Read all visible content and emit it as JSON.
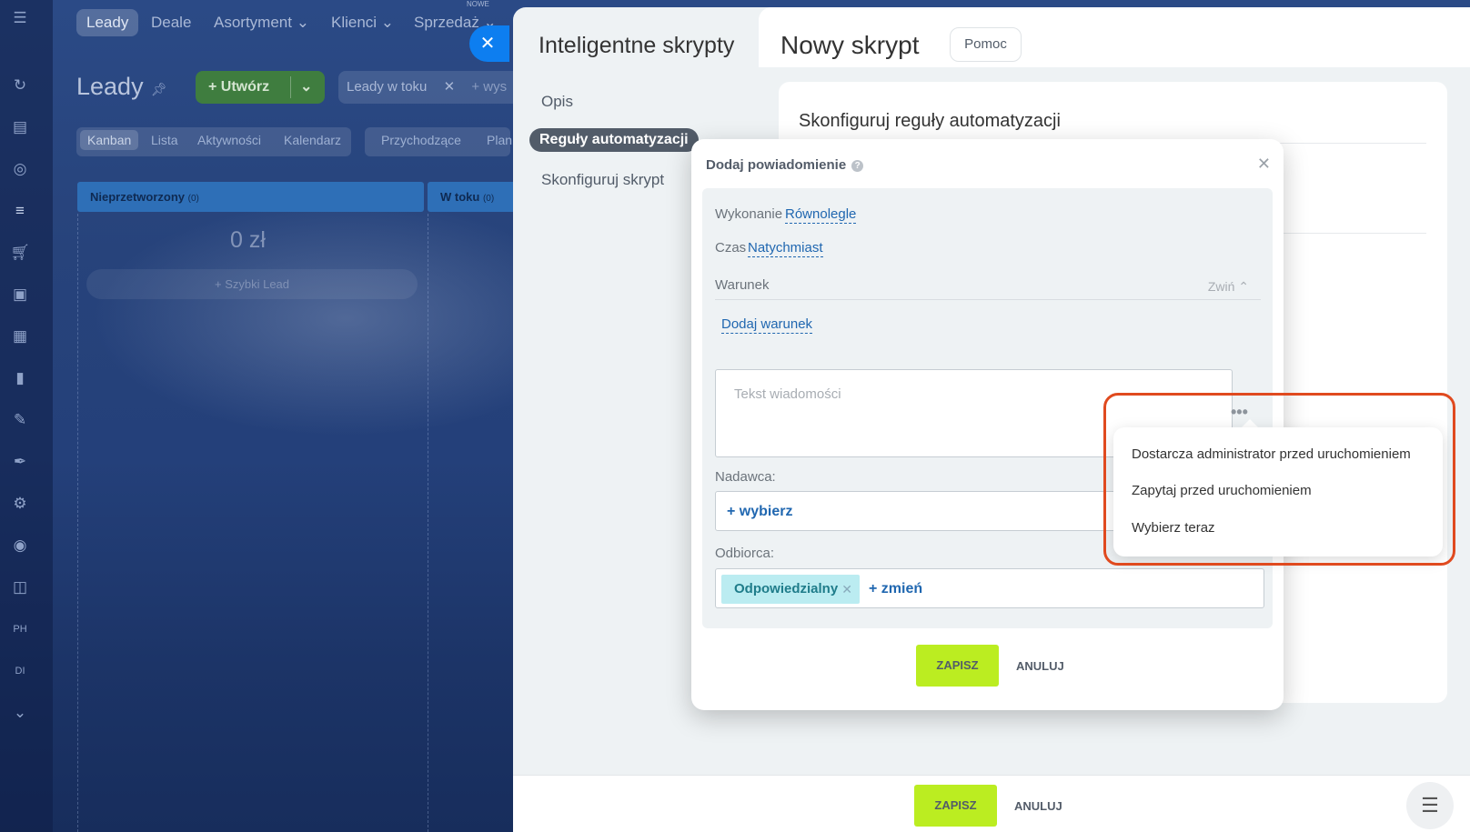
{
  "crm": {
    "nav": [
      "Leady",
      "Deale",
      "Asortyment ⌄",
      "Klienci ⌄",
      "Sprzedaż ⌄"
    ],
    "nav_badge_new": "NOWE",
    "page_title": "Leady",
    "create_label": "+ Utwórz",
    "filter_tag": "Leady w toku",
    "filter_search": "+ wys",
    "view_tabs": [
      "Kanban",
      "Lista",
      "Aktywności",
      "Kalendarz"
    ],
    "view_tabs2": [
      "Przychodzące",
      "Plan"
    ],
    "col1_title": "Nieprzetworzony",
    "col1_count": "(0)",
    "col2_title": "W toku",
    "col2_count": "(0)",
    "col1_sum": "0 zł",
    "quick_lead": "+ Szybki Lead"
  },
  "panel": {
    "title": "Inteligentne skrypty",
    "nav": [
      "Opis",
      "Reguły automatyzacji",
      "Skonfiguruj skrypt"
    ],
    "header_title": "Nowy skrypt",
    "help_label": "Pomoc",
    "card_title": "Skonfiguruj reguły automatyzacji",
    "footer_save": "ZAPISZ",
    "footer_cancel": "ANULUJ"
  },
  "popup": {
    "title": "Dodaj powiadomienie",
    "help_glyph": "?",
    "exec_label": "Wykonanie",
    "exec_value": "Równolegle",
    "time_label": "Czas",
    "time_value": "Natychmiast",
    "condition_label": "Warunek",
    "collapse_label": "Zwiń",
    "add_condition": "Dodaj warunek",
    "message_placeholder": "Tekst wiadomości",
    "sender_label": "Nadawca:",
    "sender_select": "+ wybierz",
    "recipient_label": "Odbiorca:",
    "recipient_tag": "Odpowiedzialny",
    "recipient_change": "+ zmień",
    "save": "ZAPISZ",
    "cancel": "ANULUJ"
  },
  "dropdown": {
    "items": [
      "Dostarcza administrator przed uruchomieniem",
      "Zapytaj przed uruchomieniem",
      "Wybierz teraz"
    ]
  },
  "colors": {
    "accent_green": "#bbed21",
    "link_blue": "#2067b0",
    "highlight_red": "#e04a1f"
  }
}
